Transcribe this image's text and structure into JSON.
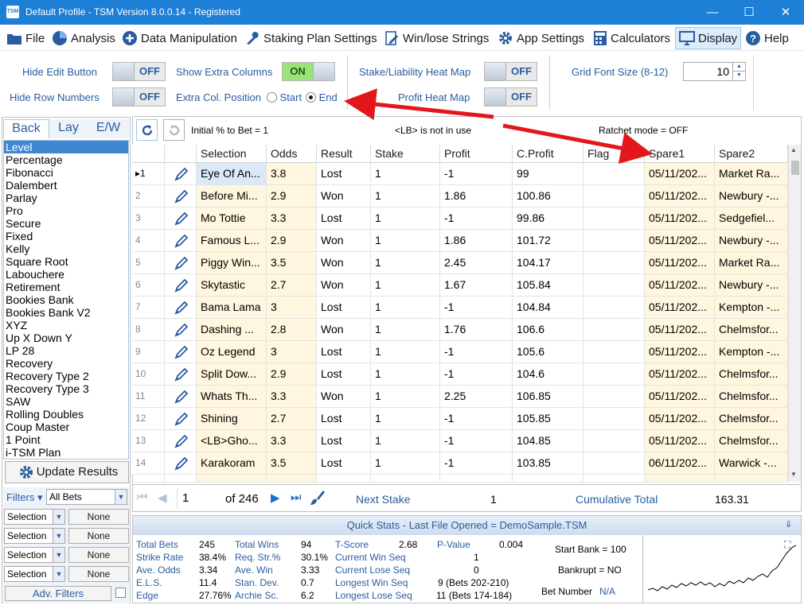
{
  "window": {
    "logo": "TSM",
    "title": "Default Profile  -  TSM Version 8.0.0.14 - Registered",
    "min_icon": "minimize-icon",
    "max_icon": "maximize-icon",
    "close_icon": "close-icon"
  },
  "menu": {
    "items": [
      {
        "label": "File",
        "icon": "folder-icon"
      },
      {
        "label": "Analysis",
        "icon": "pie-chart-icon"
      },
      {
        "label": "Data Manipulation",
        "icon": "plus-circle-icon"
      },
      {
        "label": "Staking Plan Settings",
        "icon": "wrench-icon"
      },
      {
        "label": "Win/lose Strings",
        "icon": "document-edit-icon"
      },
      {
        "label": "App Settings",
        "icon": "gear-icon"
      },
      {
        "label": "Calculators",
        "icon": "calculator-icon"
      },
      {
        "label": "Display",
        "icon": "monitor-icon"
      },
      {
        "label": "Help",
        "icon": "help-icon"
      }
    ]
  },
  "settings": {
    "hide_edit_label": "Hide Edit Button",
    "hide_edit_value": "OFF",
    "hide_row_label": "Hide Row Numbers",
    "hide_row_value": "OFF",
    "extra_cols_label": "Show Extra Columns",
    "extra_cols_value": "ON",
    "extra_pos_label": "Extra Col. Position",
    "pos_start": "Start",
    "pos_end": "End",
    "heat_stake_label": "Stake/Liability Heat Map",
    "heat_stake_value": "OFF",
    "heat_profit_label": "Profit Heat Map",
    "heat_profit_value": "OFF",
    "font_size_label": "Grid Font Size (8-12)",
    "font_size_value": "10"
  },
  "staking": {
    "tabs": [
      "Back",
      "Lay",
      "E/W"
    ],
    "plans": [
      "Level",
      "Percentage",
      "Fibonacci",
      "Dalembert",
      "Parlay",
      "Pro",
      "Secure",
      "Fixed",
      "Kelly",
      "Square Root",
      "Labouchere",
      "Retirement",
      "Bookies Bank",
      "Bookies Bank V2",
      "XYZ",
      "Up X Down Y",
      "LP 28",
      "Recovery",
      "Recovery Type 2",
      "Recovery Type 3",
      "SAW",
      "Rolling Doubles",
      "Coup Master",
      "1 Point",
      "i-TSM Plan"
    ],
    "selected": "Level",
    "update_label": "Update Results"
  },
  "filters": {
    "label": "Filters",
    "value": "All Bets",
    "rows": [
      {
        "field": "Selection",
        "value": "None"
      },
      {
        "field": "Selection",
        "value": "None"
      },
      {
        "field": "Selection",
        "value": "None"
      },
      {
        "field": "Selection",
        "value": "None"
      }
    ],
    "adv_label": "Adv. Filters"
  },
  "grid_toolbar": {
    "initial": "Initial % to Bet = 1",
    "lb_note": "<LB> is not in use",
    "ratchet": "Ratchet mode = OFF"
  },
  "grid": {
    "columns": [
      "Selection",
      "Odds",
      "Result",
      "Stake",
      "Profit",
      "C.Profit",
      "Flag",
      "Spare1",
      "Spare2"
    ],
    "rows": [
      {
        "n": "1",
        "sel": "Eye Of An...",
        "odds": "3.8",
        "res": "Lost",
        "stake": "1",
        "profit": "-1",
        "cprofit": "99",
        "flag": "",
        "s1": "05/11/202...",
        "s2": "Market Ra..."
      },
      {
        "n": "2",
        "sel": "Before Mi...",
        "odds": "2.9",
        "res": "Won",
        "stake": "1",
        "profit": "1.86",
        "cprofit": "100.86",
        "flag": "",
        "s1": "05/11/202...",
        "s2": "Newbury -..."
      },
      {
        "n": "3",
        "sel": "Mo Tottie",
        "odds": "3.3",
        "res": "Lost",
        "stake": "1",
        "profit": "-1",
        "cprofit": "99.86",
        "flag": "",
        "s1": "05/11/202...",
        "s2": "Sedgefiel..."
      },
      {
        "n": "4",
        "sel": "Famous L...",
        "odds": "2.9",
        "res": "Won",
        "stake": "1",
        "profit": "1.86",
        "cprofit": "101.72",
        "flag": "",
        "s1": "05/11/202...",
        "s2": "Newbury -..."
      },
      {
        "n": "5",
        "sel": "Piggy Win...",
        "odds": "3.5",
        "res": "Won",
        "stake": "1",
        "profit": "2.45",
        "cprofit": "104.17",
        "flag": "",
        "s1": "05/11/202...",
        "s2": "Market Ra..."
      },
      {
        "n": "6",
        "sel": "Skytastic",
        "odds": "2.7",
        "res": "Won",
        "stake": "1",
        "profit": "1.67",
        "cprofit": "105.84",
        "flag": "",
        "s1": "05/11/202...",
        "s2": "Newbury -..."
      },
      {
        "n": "7",
        "sel": "Bama Lama",
        "odds": "3",
        "res": "Lost",
        "stake": "1",
        "profit": "-1",
        "cprofit": "104.84",
        "flag": "",
        "s1": "05/11/202...",
        "s2": "Kempton -..."
      },
      {
        "n": "8",
        "sel": "Dashing ...",
        "odds": "2.8",
        "res": "Won",
        "stake": "1",
        "profit": "1.76",
        "cprofit": "106.6",
        "flag": "",
        "s1": "05/11/202...",
        "s2": "Chelmsfor..."
      },
      {
        "n": "9",
        "sel": "Oz Legend",
        "odds": "3",
        "res": "Lost",
        "stake": "1",
        "profit": "-1",
        "cprofit": "105.6",
        "flag": "",
        "s1": "05/11/202...",
        "s2": "Kempton -..."
      },
      {
        "n": "10",
        "sel": "Split Dow...",
        "odds": "2.9",
        "res": "Lost",
        "stake": "1",
        "profit": "-1",
        "cprofit": "104.6",
        "flag": "",
        "s1": "05/11/202...",
        "s2": "Chelmsfor..."
      },
      {
        "n": "11",
        "sel": "Whats Th...",
        "odds": "3.3",
        "res": "Won",
        "stake": "1",
        "profit": "2.25",
        "cprofit": "106.85",
        "flag": "",
        "s1": "05/11/202...",
        "s2": "Chelmsfor..."
      },
      {
        "n": "12",
        "sel": "Shining",
        "odds": "2.7",
        "res": "Lost",
        "stake": "1",
        "profit": "-1",
        "cprofit": "105.85",
        "flag": "",
        "s1": "05/11/202...",
        "s2": "Chelmsfor..."
      },
      {
        "n": "13",
        "sel": "<LB>Gho...",
        "odds": "3.3",
        "res": "Lost",
        "stake": "1",
        "profit": "-1",
        "cprofit": "104.85",
        "flag": "",
        "s1": "05/11/202...",
        "s2": "Chelmsfor..."
      },
      {
        "n": "14",
        "sel": "Karakoram",
        "odds": "3.5",
        "res": "Lost",
        "stake": "1",
        "profit": "-1",
        "cprofit": "103.85",
        "flag": "",
        "s1": "06/11/202...",
        "s2": "Warwick -..."
      }
    ]
  },
  "pager": {
    "page": "1",
    "of": "of 246",
    "next_stake_label": "Next Stake",
    "next_stake": "1",
    "cum_label": "Cumulative Total",
    "cum_value": "163.31"
  },
  "quick": {
    "header": "Quick Stats - Last File Opened = DemoSample.TSM",
    "col1": [
      [
        "Total Bets",
        "245"
      ],
      [
        "Strike Rate",
        "38.4%"
      ],
      [
        "Ave. Odds",
        "3.34"
      ],
      [
        "E.L.S.",
        "11.4"
      ],
      [
        "Edge",
        "27.76%"
      ]
    ],
    "col2": [
      [
        "Total Wins",
        "94"
      ],
      [
        "Req. Str.%",
        "30.1%"
      ],
      [
        "Ave. Win",
        "3.33"
      ],
      [
        "Stan. Dev.",
        "0.7"
      ],
      [
        "Archie Sc.",
        "6.2"
      ]
    ],
    "tscore_label": "T-Score",
    "tscore": "2.68",
    "pvalue_label": "P-Value",
    "pvalue": "0.004",
    "cur_win_label": "Current Win Seq",
    "cur_win": "1",
    "cur_lose_label": "Current Lose Seq",
    "cur_lose": "0",
    "long_win_label": "Longest Win Seq",
    "long_win": "9  (Bets 202-210)",
    "long_lose_label": "Longest Lose Seq",
    "long_lose": "11  (Bets 174-184)",
    "start_bank": "Start Bank = 100",
    "bankrupt": "Bankrupt = NO",
    "bet_number_label": "Bet Number",
    "bet_number": "N/A"
  },
  "colors": {
    "titlebar": "#1e7fd6",
    "accent": "#2a5d9f",
    "annotation_arrow": "#e3161b",
    "highlight_col": "#fff6df"
  }
}
